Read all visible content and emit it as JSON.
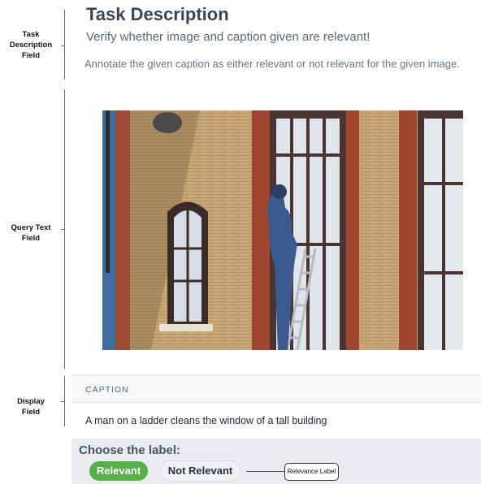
{
  "annotations": {
    "task_description_field": "Task\nDescription\nField",
    "query_text_field": "Query Text\nField",
    "display_field": "Display\nField",
    "relevance_label": "Relevance Label"
  },
  "task": {
    "title": "Task Description",
    "subtitle": "Verify whether image and caption given are relevant!",
    "instruction": "Annotate the given caption as either relevant or not relevant for the given image."
  },
  "caption": {
    "header": "CAPTION",
    "text": "A man on a ladder cleans the window of a tall building"
  },
  "label_choice": {
    "title": "Choose the label:",
    "options": [
      "Relevant",
      "Not Relevant"
    ],
    "selected": "Relevant",
    "selected_color": "#55b047"
  }
}
